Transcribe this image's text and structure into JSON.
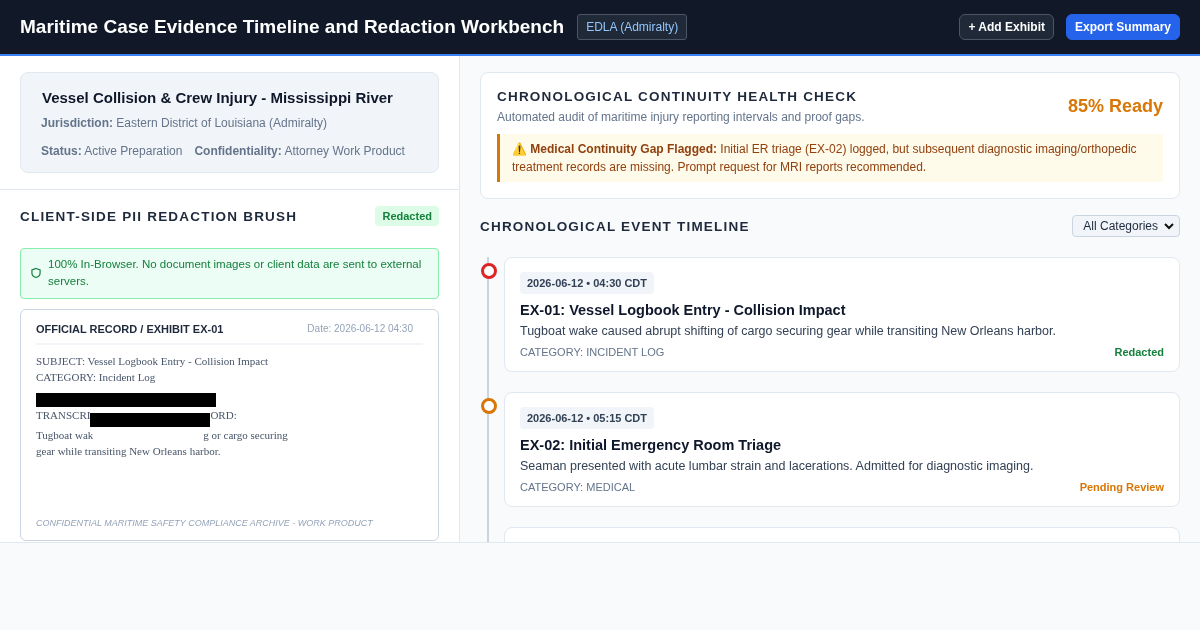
{
  "header": {
    "title": "Maritime Case Evidence Timeline and Redaction Workbench",
    "court_badge": "EDLA (Admiralty)",
    "buttons": [
      {
        "label": "+ Add Exhibit",
        "kind": "secondary"
      },
      {
        "label": "Export Summary",
        "kind": "primary"
      }
    ]
  },
  "case": {
    "title": "Vessel Collision & Crew Injury - Mississippi River",
    "jurisdiction": "**Jurisdiction:** Eastern District of Louisiana (Admiralty)",
    "status": "**Status:** Active Preparation",
    "confidentiality": "**Confidentiality:** Attorney Work Product"
  },
  "redaction": {
    "title": "CLIENT-SIDE PII REDACTION BRUSH",
    "badge": "Redacted",
    "notice": "100% In-Browser. No document images or client data are sent to external servers.",
    "document": {
      "heading": "OFFICIAL RECORD / EXHIBIT EX-01",
      "date": "Date: 2026-06-12 04:30",
      "subject": "SUBJECT: Vessel Logbook Entry - Collision Impact",
      "category": "CATEGORY: Incident Log",
      "redacted_lines": [
        {
          "before": "TRANSCRI",
          "after": "ORD:"
        },
        {
          "before": "Tugboat wak",
          "after": "g or cargo securing"
        }
      ],
      "last_line": "gear while transiting New Orleans harbor.",
      "footer": "CONFIDENTIAL MARITIME SAFETY COMPLIANCE ARCHIVE - WORK PRODUCT"
    }
  },
  "health": {
    "title": "CHRONOLOGICAL CONTINUITY HEALTH CHECK",
    "subtitle": "Automated audit of maritime injury reporting intervals and proof gaps.",
    "readiness": "85% Ready",
    "alert": "⚠️ **Medical Continuity Gap Flagged:** Initial ER triage (EX-02) logged, but subsequent diagnostic imaging/orthopedic treatment records are missing. Prompt request for MRI reports recommended."
  },
  "timeline": {
    "title": "CHRONOLOGICAL EVENT TIMELINE",
    "filter": "All Categories",
    "events": [
      {
        "timestamp": "2026-06-12 • 04:30 CDT",
        "title": "EX-01: Vessel Logbook Entry - Collision Impact",
        "description": "Tugboat wake caused abrupt shifting of cargo securing gear while transiting New Orleans harbor.",
        "category": "CATEGORY: INCIDENT LOG",
        "status": "Redacted",
        "kind": "done",
        "color": "#dc2626"
      },
      {
        "timestamp": "2026-06-12 • 05:15 CDT",
        "title": "EX-02: Initial Emergency Room Triage",
        "description": "Seaman presented with acute lumbar strain and lacerations. Admitted for diagnostic imaging.",
        "category": "CATEGORY: MEDICAL",
        "status": "Pending Review",
        "kind": "pending",
        "color": "#d97706"
      }
    ],
    "more_events_below": true
  }
}
